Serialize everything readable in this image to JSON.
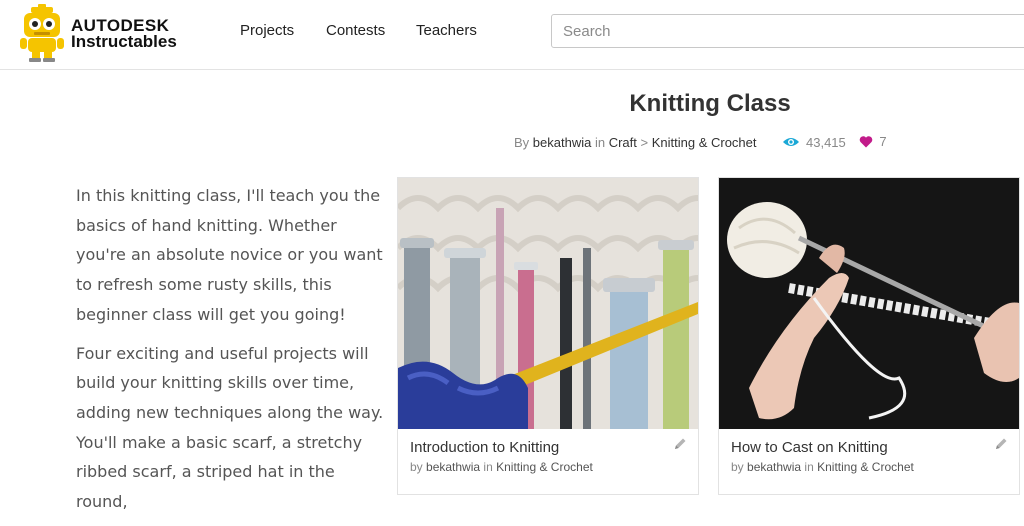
{
  "brand": {
    "line1": "AUTODESK",
    "line2": "Instructables"
  },
  "nav": [
    "Projects",
    "Contests",
    "Teachers"
  ],
  "search": {
    "placeholder": "Search",
    "value": ""
  },
  "page": {
    "title": "Knitting Class",
    "by_prefix": "By",
    "author": "bekathwia",
    "in_word": "in",
    "category": "Craft",
    "separator": ">",
    "subcategory": "Knitting & Crochet",
    "views": "43,415",
    "favorites": "7"
  },
  "description": [
    "In this knitting class, I'll teach you the basics of hand knitting. Whether you're an absolute novice or you want to refresh some rusty skills, this beginner class will get you going!",
    "Four exciting and useful projects will build your knitting skills over time, adding new techniques along the way. You'll make a basic scarf, a stretchy ribbed scarf, a striped hat in the round,"
  ],
  "cards": [
    {
      "title": "Introduction to Knitting",
      "by": "by",
      "author": "bekathwia",
      "in": "in",
      "category": "Knitting & Crochet"
    },
    {
      "title": "How to Cast on Knitting",
      "by": "by",
      "author": "bekathwia",
      "in": "in",
      "category": "Knitting & Crochet"
    }
  ],
  "colors": {
    "views_icon": "#1aa8d6",
    "heart_icon": "#c21b8a",
    "robot_yellow": "#f5c400"
  },
  "icons": {
    "logo": "robot-logo-icon",
    "views": "eye-icon",
    "favorites": "heart-icon",
    "edit": "pencil-icon"
  }
}
